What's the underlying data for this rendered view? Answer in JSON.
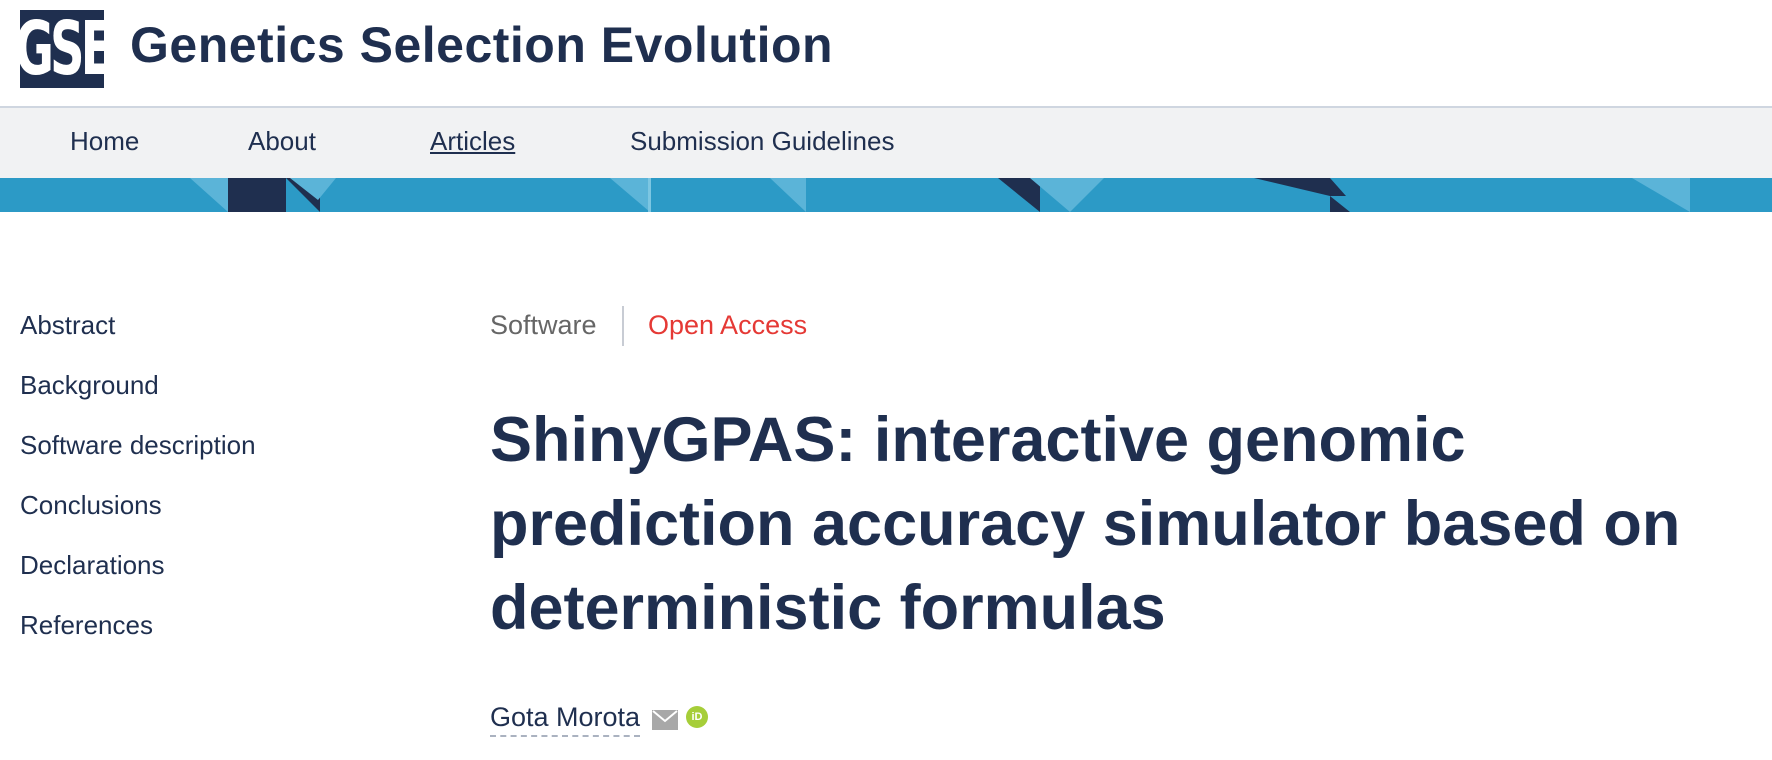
{
  "header": {
    "logo_text": "GSE",
    "journal_title": "Genetics Selection Evolution"
  },
  "nav": {
    "items": [
      {
        "label": "Home"
      },
      {
        "label": "About"
      },
      {
        "label": "Articles"
      },
      {
        "label": "Submission Guidelines"
      }
    ],
    "active": "Articles"
  },
  "sidebar": {
    "items": [
      {
        "label": "Abstract"
      },
      {
        "label": "Background"
      },
      {
        "label": "Software description"
      },
      {
        "label": "Conclusions"
      },
      {
        "label": "Declarations"
      },
      {
        "label": "References"
      }
    ]
  },
  "article": {
    "type": "Software",
    "access": "Open Access",
    "title": "ShinyGPAS: interactive genomic prediction accuracy simulator based on deterministic formulas",
    "author": "Gota Morota"
  },
  "icons": {
    "mail": "mail-icon",
    "orcid": "orcid-icon",
    "orcid_text": "iD"
  },
  "colors": {
    "brand_navy": "#1f2f4f",
    "banner_blue": "#2c9ac6",
    "open_access_red": "#e53935",
    "orcid_green": "#a6ce39"
  }
}
